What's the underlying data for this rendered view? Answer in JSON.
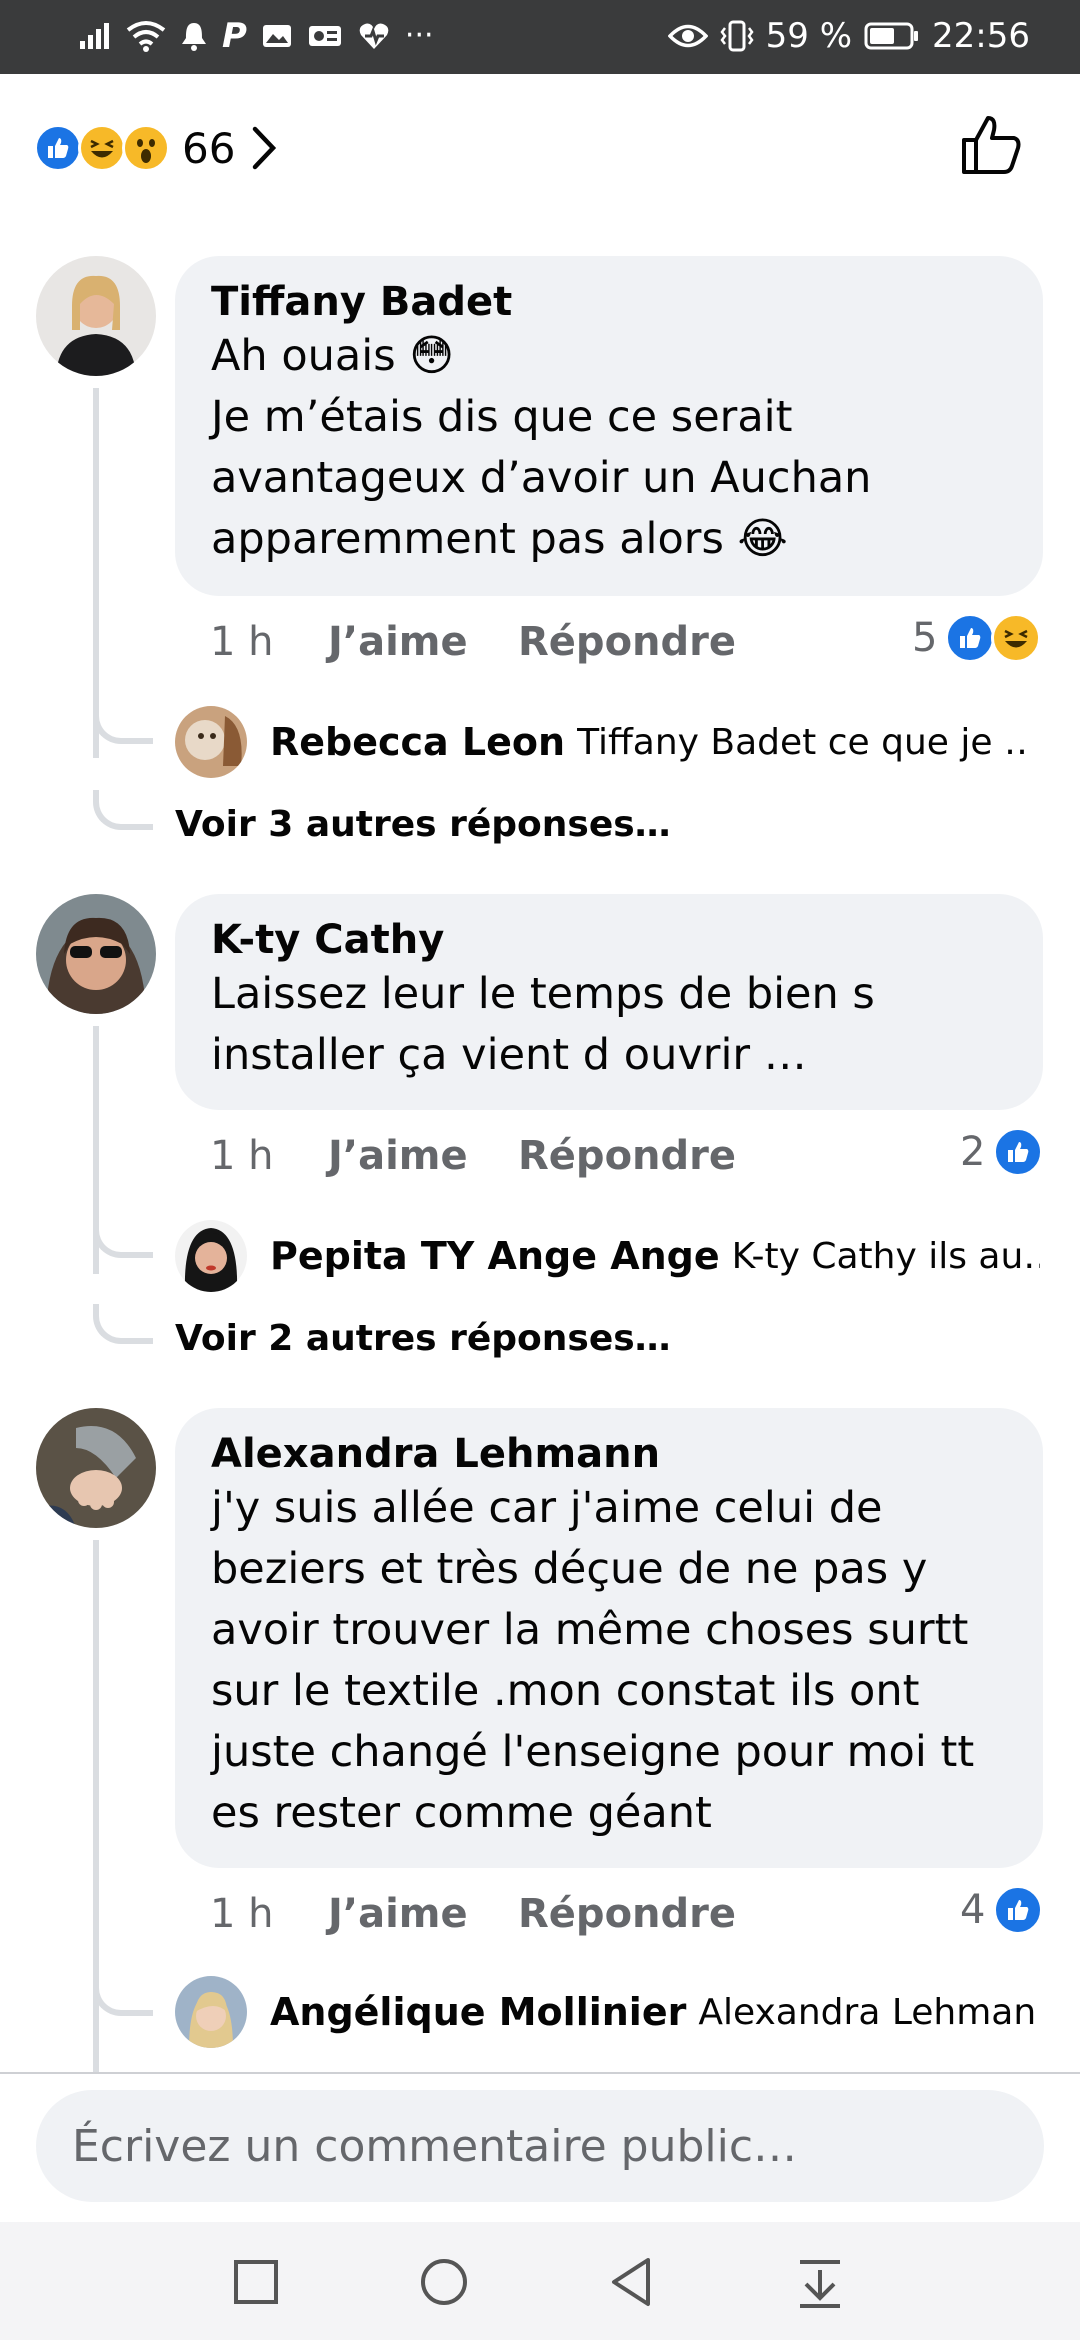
{
  "status_bar": {
    "p_app": "P",
    "more": "···",
    "battery": "59 %",
    "time": "22:56"
  },
  "reactions_summary": {
    "count": "66",
    "icons": [
      "like-icon",
      "haha-icon",
      "wow-icon"
    ]
  },
  "comments": [
    {
      "author": "Tiffany Badet",
      "text": "Ah ouais 😳\nJe m’étais dis que ce serait avantageux d’avoir un Auchan apparemment pas alors 😂",
      "time": "1 h",
      "like_label": "J’aime",
      "reply_label": "Répondre",
      "reaction_count": "5",
      "reply_preview": {
        "author": "Rebecca Leon",
        "text": "Tiffany Badet ce que je …"
      },
      "see_more": "Voir 3 autres réponses…"
    },
    {
      "author": "K-ty Cathy",
      "text": "Laissez leur le temps de bien s installer ça vient d ouvrir …",
      "time": "1 h",
      "like_label": "J’aime",
      "reply_label": "Répondre",
      "reaction_count": "2",
      "reply_preview": {
        "author": "Pepita TY Ange Ange",
        "text": "K-ty Cathy ils au…"
      },
      "see_more": "Voir 2 autres réponses…"
    },
    {
      "author": "Alexandra Lehmann",
      "text": "j'y suis allée car j'aime celui de beziers et très déçue de ne pas y avoir trouver la même choses surtt sur le textile .mon constat ils ont juste changé l'enseigne pour moi tt es rester comme géant",
      "time": "1 h",
      "like_label": "J’aime",
      "reply_label": "Répondre",
      "reaction_count": "4",
      "reply_preview": {
        "author": "Angélique Mollinier",
        "text": "Alexandra Lehman…"
      }
    }
  ],
  "composer": {
    "placeholder": "Écrivez un commentaire public…"
  },
  "colors": {
    "accent": "#1b74e4",
    "bubble": "#f0f2f5",
    "muted": "#65676b",
    "haha": "#f7b928"
  }
}
